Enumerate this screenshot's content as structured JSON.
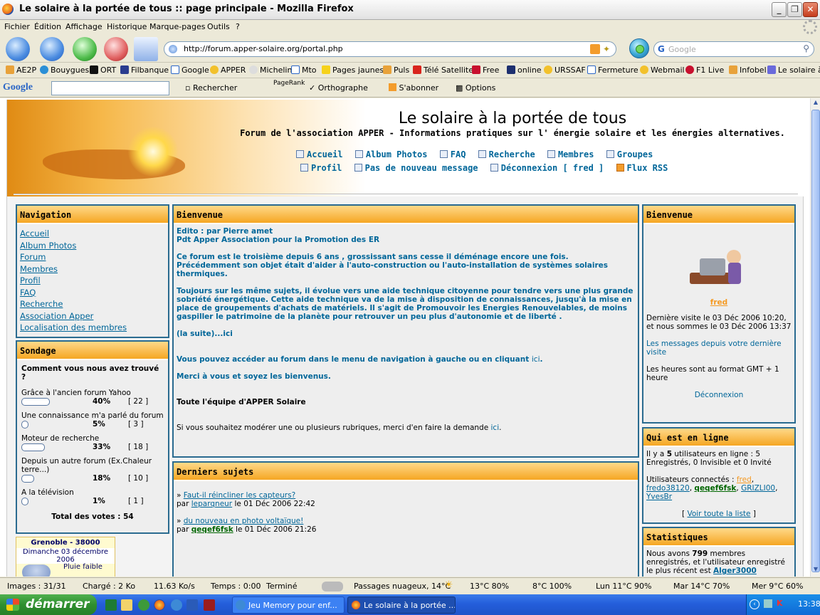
{
  "window": {
    "title": "Le solaire à la portée de tous :: page principale - Mozilla Firefox"
  },
  "menu": [
    "Fichier",
    "Édition",
    "Affichage",
    "Historique",
    "Marque-pages",
    "Outils",
    "?"
  ],
  "address": {
    "url": "http://forum.apper-solaire.org/portal.php"
  },
  "search": {
    "placeholder": "Google"
  },
  "bookmarks": [
    "AE2P",
    "Bouygues",
    "ORT",
    "Filbanque",
    "Google",
    "APPER",
    "Michelin",
    "Mto",
    "Pages jaunes",
    "Puls",
    "Télé Satellite",
    "Free",
    "online",
    "URSSAF",
    "Fermeture",
    "Webmail",
    "F1 Live",
    "Infobel",
    "Le solaire à"
  ],
  "google_toolbar": {
    "logo": "Google",
    "rechercher": "Rechercher",
    "pagerank": "PageRank",
    "orthographe": "Orthographe",
    "sabonner": "S'abonner",
    "options": "Options"
  },
  "site": {
    "title": "Le solaire à la portée de tous",
    "subtitle": "Forum de l'association APPER - Informations pratiques sur l' énergie solaire et les énergies alternatives.",
    "links_row1": [
      "Accueil",
      "Album Photos",
      "FAQ",
      "Recherche",
      "Membres",
      "Groupes"
    ],
    "links_row2": [
      "Profil",
      "Pas de nouveau message",
      "Déconnexion [ fred ]",
      "Flux RSS"
    ]
  },
  "navigation": {
    "title": "Navigation",
    "items": [
      "Accueil",
      "Album Photos",
      "Forum ",
      "Membres",
      "Profil",
      "FAQ",
      "Recherche",
      "Association Apper",
      "Localisation des membres"
    ]
  },
  "poll": {
    "title": "Sondage",
    "question": "Comment vous nous avez trouvé ?",
    "options": [
      {
        "label": "Grâce à l'ancien forum Yahoo",
        "pct": "40%",
        "count": "[ 22 ]",
        "value": 40
      },
      {
        "label": "Une connaissance m'a parlé du forum",
        "pct": "5%",
        "count": "[ 3 ]",
        "value": 5
      },
      {
        "label": "Moteur de recherche",
        "pct": "33%",
        "count": "[ 18 ]",
        "value": 33
      },
      {
        "label": "Depuis un autre forum (Ex.Chaleur terre...)",
        "pct": "18%",
        "count": "[ 10 ]",
        "value": 18
      },
      {
        "label": "A la télévision",
        "pct": "1%",
        "count": "[ 1 ]",
        "value": 1
      }
    ],
    "total": "Total des votes : 54"
  },
  "weather": {
    "city": "Grenoble - 38000",
    "date": "Dimanche 03 décembre 2006",
    "desc": "Pluie faible"
  },
  "welcome": {
    "title": "Bienvenue",
    "edito": "Edito : par Pierre amet",
    "pdt": "Pdt Apper Association pour la Promotion des ER",
    "p1": "Ce forum est le troisième depuis 6 ans , grossissant sans cesse il déménage encore une fois.",
    "p1b": "Précédemment son objet était d'aider à l'auto-construction ou l'auto-installation de systèmes solaires thermiques.",
    "p2": "Toujours sur les même sujets, il évolue vers une aide technique citoyenne pour tendre vers une plus grande sobriété énergétique. Cette aide technique va de la mise à disposition de connaissances, jusqu'à la mise en place de groupements d'achats de matériels. Il s'agit de Promouvoir les Energies Renouvelables, de moins gaspiller le patrimoine de la planète pour retrouver un peu plus d'autonomie et de liberté .",
    "suite": "(la suite)...ici",
    "access": "Vous pouvez accéder au forum dans le menu de navigation à gauche ou en cliquant ",
    "ici": "ici",
    "merci": "Merci à vous et soyez les bienvenus.",
    "equipe": "Toute l'équipe d'APPER Solaire",
    "moderer": "Si vous souhaitez modérer une ou plusieurs rubriques, merci d'en faire la demande "
  },
  "latest": {
    "title": "Derniers sujets",
    "items": [
      {
        "subject": "Faut-il réincliner les capteurs?",
        "by": "par",
        "author": "leparqneur",
        "date": " le 01 Déc 2006 22:42"
      },
      {
        "subject": "du nouveau en photo voltaïque!",
        "by": "par",
        "author": "qeqef6fsk",
        "date": " le 01 Déc 2006 21:26"
      }
    ]
  },
  "user_box": {
    "title": "Bienvenue",
    "username": "fred",
    "last_visit": "Dernière visite le 03 Déc 2006 10:20, et nous sommes le 03 Déc 2006 13:37",
    "messages_link": "Les messages depuis votre dernière visite",
    "timezone": "Les heures sont au format GMT + 1 heure",
    "logout": "Déconnexion"
  },
  "online": {
    "title": "Qui est en ligne",
    "summary_a": "Il y a ",
    "summary_n": "5",
    "summary_b": " utilisateurs en ligne : 5 Enregistrés, 0 Invisible et 0 Invité",
    "connected_label": "Utilisateurs connectés : ",
    "users": [
      "fred",
      "fredo38120",
      "qeqef6fsk",
      "GRIZLI00",
      "YvesBr"
    ],
    "see_all": "Voir toute la liste"
  },
  "stats": {
    "title": "Statistiques",
    "a": "Nous avons ",
    "members": "799",
    "b": " membres enregistrés, et l'utilisateur enregistré le plus récent est ",
    "newest": "Alger3000"
  },
  "status": {
    "images": "Images : 31/31",
    "loaded": "Chargé : 2 Ko",
    "speed": "11.63 Ko/s",
    "time": "Temps : 0:00",
    "state": "Terminé",
    "weather_now": "Passages nuageux, 14°C",
    "w1": "13°C 80%",
    "w2": "8°C 100%",
    "w3": "Lun 11°C 90%",
    "w4": "Mar 14°C 70%",
    "w5": "Mer 9°C 60%"
  },
  "taskbar": {
    "start": "démarrer",
    "task1": "Jeu Memory pour enf...",
    "task2": "Le solaire à la portée ...",
    "clock": "13:38"
  }
}
